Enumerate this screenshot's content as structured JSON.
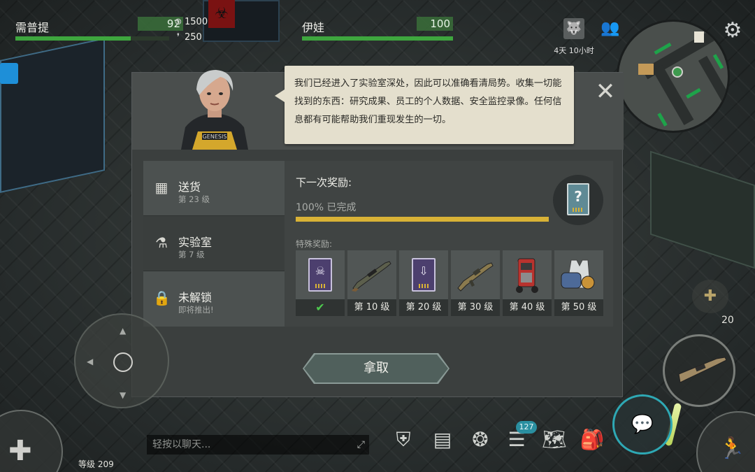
{
  "players": [
    {
      "name": "需普提",
      "hp": "92",
      "hp_fraction": 0.75
    },
    {
      "name": "伊娃",
      "hp": "100",
      "hp_fraction": 1.0
    }
  ],
  "resources": {
    "coins": "1500",
    "ammo": "250"
  },
  "timer_text": "4天 10小时",
  "dialog": {
    "speech": "我们已经进入了实验室深处，因此可以准确看清局势。收集一切能找到的东西：研究成果、员工的个人数据、安全监控录像。任何信息都有可能帮助我们重现发生的一切。",
    "close_symbol": "✕",
    "tabs": [
      {
        "label": "送货",
        "sub": "第 23 级",
        "icon": "boxes-icon"
      },
      {
        "label": "实验室",
        "sub": "第 7 级",
        "icon": "flask-icon"
      },
      {
        "label": "未解锁",
        "sub": "即将推出!",
        "icon": "lock-icon"
      }
    ],
    "next_reward_label": "下一次奖励:",
    "progress_text": "100% 已完成",
    "progress": 1.0,
    "special_label": "特殊奖励:",
    "rewards": [
      {
        "level": "",
        "claimed": true,
        "icon": "skull-card-icon"
      },
      {
        "level": "第 10 级",
        "icon": "sniper-rifle-icon"
      },
      {
        "level": "第 20 级",
        "icon": "figure-card-icon"
      },
      {
        "level": "第 30 级",
        "icon": "shotgun-icon"
      },
      {
        "level": "第 40 级",
        "icon": "generator-icon"
      },
      {
        "level": "第 50 级",
        "icon": "armor-vest-icon"
      }
    ],
    "claim_label": "拿取"
  },
  "hud": {
    "chat_placeholder": "轻按以聊天...",
    "level_text": "等级 209",
    "badge_count": "127",
    "bag_count": "20"
  },
  "colors": {
    "accent_green": "#3ea63e",
    "progress_gold": "#d9b236",
    "chat_teal": "#2ea8b4"
  }
}
